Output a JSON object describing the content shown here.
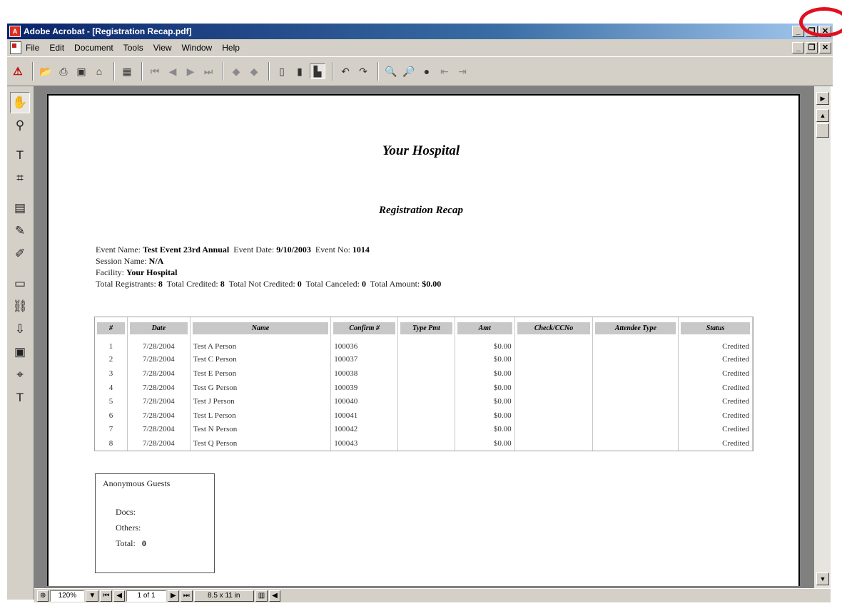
{
  "window": {
    "title": "Adobe Acrobat - [Registration Recap.pdf]",
    "min": "_",
    "restore": "❐",
    "close": "✕"
  },
  "menu": [
    "File",
    "Edit",
    "Document",
    "Tools",
    "View",
    "Window",
    "Help"
  ],
  "toolbar_icons": [
    "acrobat-logo",
    "open-icon",
    "print-icon",
    "save-icon",
    "email-icon",
    "thumbnails-icon",
    "first-page-icon",
    "previous-page-icon",
    "next-page-icon",
    "last-page-icon",
    "go-back-icon",
    "go-forward-icon",
    "actual-size-icon",
    "fit-page-icon",
    "fit-width-icon",
    "rotate-left-icon",
    "rotate-right-icon",
    "find-icon",
    "search-icon",
    "search-results-icon",
    "previous-highlight-icon",
    "next-highlight-icon"
  ],
  "left_tools": [
    "hand-tool-icon",
    "zoom-tool-icon",
    "text-select-tool-icon",
    "crop-tool-icon",
    "note-tool-icon",
    "pencil-tool-icon",
    "highlight-tool-icon",
    "form-tool-icon",
    "link-tool-icon",
    "article-tool-icon",
    "movie-tool-icon",
    "touchup-object-icon",
    "touchup-text-icon"
  ],
  "document": {
    "title": "Your Hospital",
    "subtitle": "Registration Recap",
    "event_name_label": "Event Name:",
    "event_name": "Test Event 23rd Annual",
    "event_date_label": "Event Date:",
    "event_date": "9/10/2003",
    "event_no_label": "Event No:",
    "event_no": "1014",
    "session_label": "Session Name:",
    "session": "N/A",
    "facility_label": "Facility:",
    "facility": "Your Hospital",
    "total_registrants_label": "Total Registrants:",
    "total_registrants": "8",
    "total_credited_label": "Total Credited:",
    "total_credited": "8",
    "total_not_credited_label": "Total Not Credited:",
    "total_not_credited": "0",
    "total_canceled_label": "Total Canceled:",
    "total_canceled": "0",
    "total_amount_label": "Total Amount:",
    "total_amount": "$0.00",
    "columns": [
      "#",
      "Date",
      "Name",
      "Confirm #",
      "Type Pmt",
      "Amt",
      "Check/CCNo",
      "Attendee Type",
      "Status"
    ],
    "rows": [
      [
        "1",
        "7/28/2004",
        "Test A Person",
        "100036",
        "",
        "$0.00",
        "",
        "",
        "Credited"
      ],
      [
        "2",
        "7/28/2004",
        "Test C Person",
        "100037",
        "",
        "$0.00",
        "",
        "",
        "Credited"
      ],
      [
        "3",
        "7/28/2004",
        "Test E Person",
        "100038",
        "",
        "$0.00",
        "",
        "",
        "Credited"
      ],
      [
        "4",
        "7/28/2004",
        "Test G Person",
        "100039",
        "",
        "$0.00",
        "",
        "",
        "Credited"
      ],
      [
        "5",
        "7/28/2004",
        "Test J Person",
        "100040",
        "",
        "$0.00",
        "",
        "",
        "Credited"
      ],
      [
        "6",
        "7/28/2004",
        "Test L Person",
        "100041",
        "",
        "$0.00",
        "",
        "",
        "Credited"
      ],
      [
        "7",
        "7/28/2004",
        "Test N Person",
        "100042",
        "",
        "$0.00",
        "",
        "",
        "Credited"
      ],
      [
        "8",
        "7/28/2004",
        "Test Q Person",
        "100043",
        "",
        "$0.00",
        "",
        "",
        "Credited"
      ]
    ],
    "guests": {
      "heading": "Anonymous Guests",
      "docs": "Docs:",
      "others": "Others:",
      "total": "Total:",
      "total_value": "0"
    }
  },
  "status": {
    "zoom": "120%",
    "page": "1 of 1",
    "page_size": "8.5 x 11 in"
  },
  "highlight_color": "#e11020"
}
